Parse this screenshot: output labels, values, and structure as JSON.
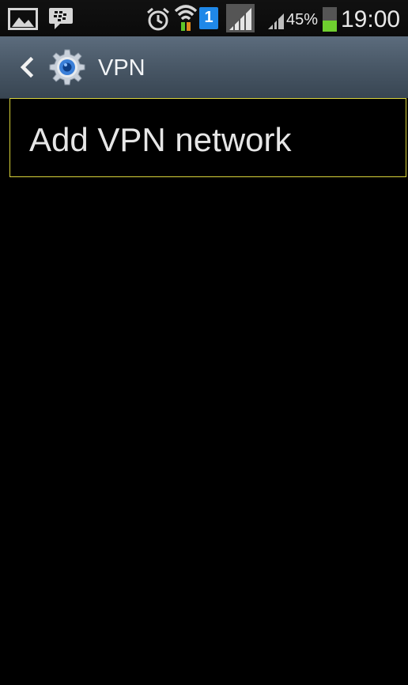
{
  "status_bar": {
    "battery_percent": "45%",
    "battery_level": 0.45,
    "time": "19:00",
    "sim_number": "1",
    "icons": [
      "gallery-icon",
      "bbm-icon",
      "alarm-icon",
      "wifi-icon",
      "sim-icon",
      "signal-icon",
      "signal-icon",
      "battery-icon"
    ],
    "battery_color": "#6fcf2f",
    "sim_color": "#1f88e8"
  },
  "action_bar": {
    "title": "VPN",
    "icon": "settings-gear-icon",
    "back_icon": "chevron-left-icon",
    "accent_color": "#3a7fd8"
  },
  "list": {
    "items": [
      {
        "label": "Add VPN network",
        "highlight_color": "#d8d23a"
      }
    ]
  }
}
